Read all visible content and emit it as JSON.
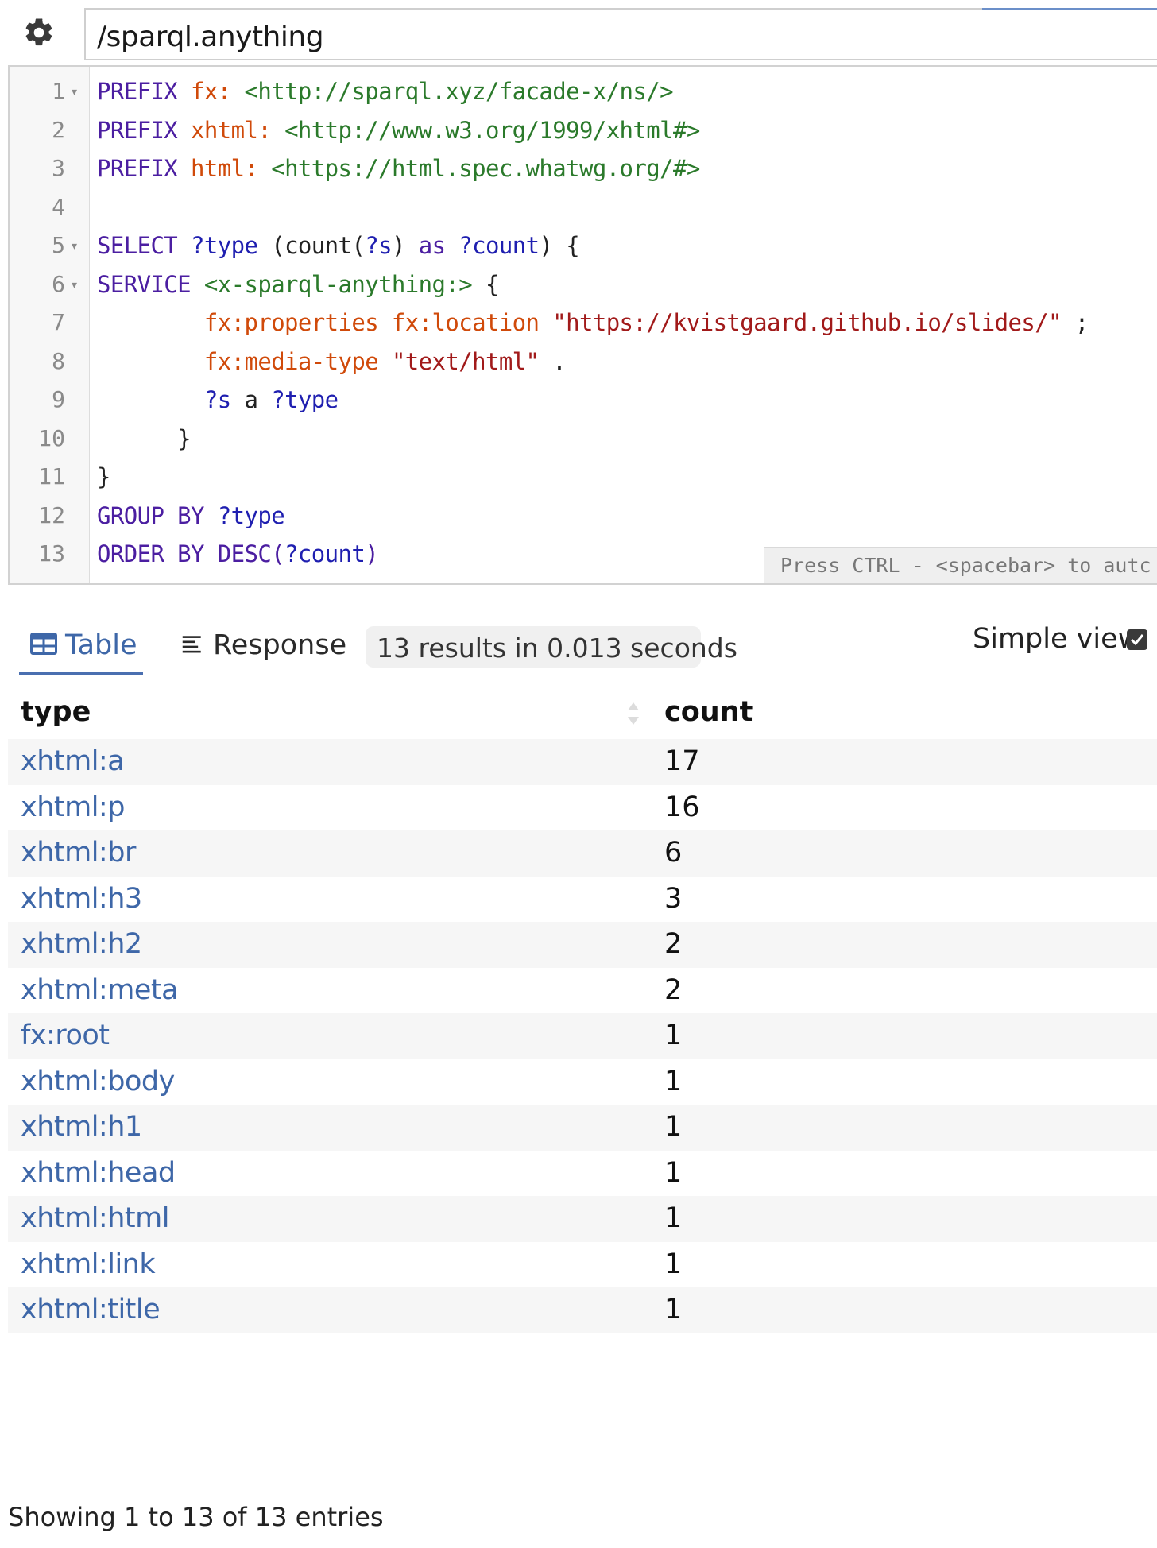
{
  "endpoint": {
    "value": "/sparql.anything"
  },
  "editor": {
    "lines": [
      {
        "n": "1",
        "fold": true,
        "tokens": [
          [
            "kw",
            "PREFIX "
          ],
          [
            "pfx",
            "fx: "
          ],
          [
            "iri",
            "<http://sparql.xyz/facade-x/ns/>"
          ]
        ]
      },
      {
        "n": "2",
        "fold": false,
        "tokens": [
          [
            "kw",
            "PREFIX "
          ],
          [
            "pfx",
            "xhtml: "
          ],
          [
            "iri",
            "<http://www.w3.org/1999/xhtml#>"
          ]
        ]
      },
      {
        "n": "3",
        "fold": false,
        "tokens": [
          [
            "kw",
            "PREFIX "
          ],
          [
            "pfx",
            "html: "
          ],
          [
            "iri",
            "<https://html.spec.whatwg.org/#>"
          ]
        ]
      },
      {
        "n": "4",
        "fold": false,
        "tokens": []
      },
      {
        "n": "5",
        "fold": true,
        "tokens": [
          [
            "kw",
            "SELECT "
          ],
          [
            "var",
            "?type "
          ],
          [
            "punc",
            "(count("
          ],
          [
            "var",
            "?s"
          ],
          [
            "punc",
            ") "
          ],
          [
            "kw",
            "as "
          ],
          [
            "var",
            "?count"
          ],
          [
            "punc",
            ") {"
          ]
        ]
      },
      {
        "n": "6",
        "fold": true,
        "tokens": [
          [
            "kw",
            "SERVICE "
          ],
          [
            "iri",
            "<x-sparql-anything:> "
          ],
          [
            "punc",
            "{"
          ]
        ]
      },
      {
        "n": "7",
        "fold": false,
        "tokens": [
          [
            "punc",
            "        "
          ],
          [
            "pfx",
            "fx:properties fx:location "
          ],
          [
            "str",
            "\"https://kvistgaard.github.io/slides/\" "
          ],
          [
            "punc",
            ";"
          ]
        ]
      },
      {
        "n": "8",
        "fold": false,
        "tokens": [
          [
            "punc",
            "        "
          ],
          [
            "pfx",
            "fx:media-type "
          ],
          [
            "str",
            "\"text/html\" "
          ],
          [
            "punc",
            "."
          ]
        ]
      },
      {
        "n": "9",
        "fold": false,
        "tokens": [
          [
            "punc",
            "        "
          ],
          [
            "var",
            "?s "
          ],
          [
            "punc",
            "a "
          ],
          [
            "var",
            "?type"
          ]
        ]
      },
      {
        "n": "10",
        "fold": false,
        "tokens": [
          [
            "punc",
            "      }"
          ]
        ]
      },
      {
        "n": "11",
        "fold": false,
        "tokens": [
          [
            "punc",
            "}"
          ]
        ]
      },
      {
        "n": "12",
        "fold": false,
        "tokens": [
          [
            "kw",
            "GROUP BY "
          ],
          [
            "var",
            "?type"
          ]
        ]
      },
      {
        "n": "13",
        "fold": false,
        "tokens": [
          [
            "kw",
            "ORDER BY DESC("
          ],
          [
            "var",
            "?count"
          ],
          [
            "kw",
            ")"
          ]
        ]
      }
    ],
    "hint": "Press CTRL - <spacebar> to autc"
  },
  "tabs": {
    "table_label": "Table",
    "response_label": "Response",
    "results_summary": "13 results in 0.013 seconds",
    "simple_view_label": "Simple view"
  },
  "table": {
    "columns": [
      "type",
      "count"
    ],
    "rows": [
      [
        "xhtml:a",
        "17"
      ],
      [
        "xhtml:p",
        "16"
      ],
      [
        "xhtml:br",
        "6"
      ],
      [
        "xhtml:h3",
        "3"
      ],
      [
        "xhtml:h2",
        "2"
      ],
      [
        "xhtml:meta",
        "2"
      ],
      [
        "fx:root",
        "1"
      ],
      [
        "xhtml:body",
        "1"
      ],
      [
        "xhtml:h1",
        "1"
      ],
      [
        "xhtml:head",
        "1"
      ],
      [
        "xhtml:html",
        "1"
      ],
      [
        "xhtml:link",
        "1"
      ],
      [
        "xhtml:title",
        "1"
      ]
    ],
    "footer": "Showing 1 to 13 of 13 entries"
  },
  "colors": {
    "link": "#3e67a8",
    "keyword": "#4b1ea1",
    "prefix": "#d04a0a",
    "iri": "#2b7a2b",
    "variable": "#1f1fb0",
    "string": "#a11a1a"
  }
}
